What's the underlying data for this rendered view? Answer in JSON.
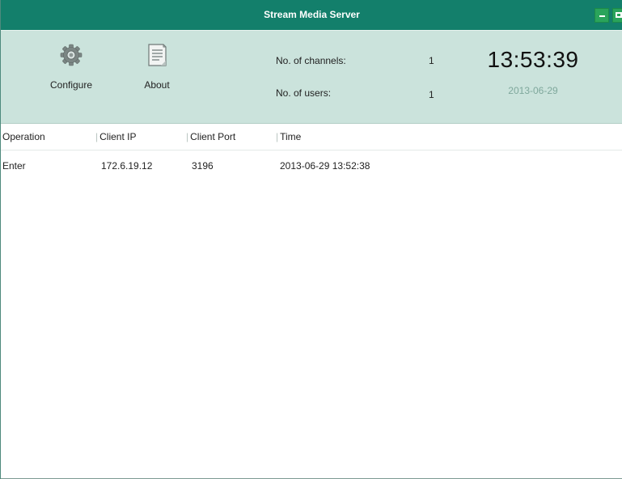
{
  "window": {
    "title": "Stream Media Server"
  },
  "toolbar": {
    "configure_label": "Configure",
    "about_label": "About",
    "channels_label": "No. of channels:",
    "channels_value": "1",
    "users_label": "No. of users:",
    "users_value": "1",
    "clock_time": "13:53:39",
    "clock_date": "2013-06-29"
  },
  "table": {
    "columns": [
      "Operation",
      "Client IP",
      "Client Port",
      "Time"
    ],
    "rows": [
      [
        "Enter",
        "172.6.19.12",
        "3196",
        "2013-06-29 13:52:38"
      ]
    ]
  },
  "icons": {
    "configure": "gear-icon",
    "about": "document-icon",
    "minimize": "minimize-icon",
    "maximize": "maximize-icon"
  },
  "colors": {
    "titlebar": "#137f6b",
    "toolbar_bg": "#cbe3dc",
    "window_button": "#2aa45b",
    "date_text": "#7fa89c"
  }
}
